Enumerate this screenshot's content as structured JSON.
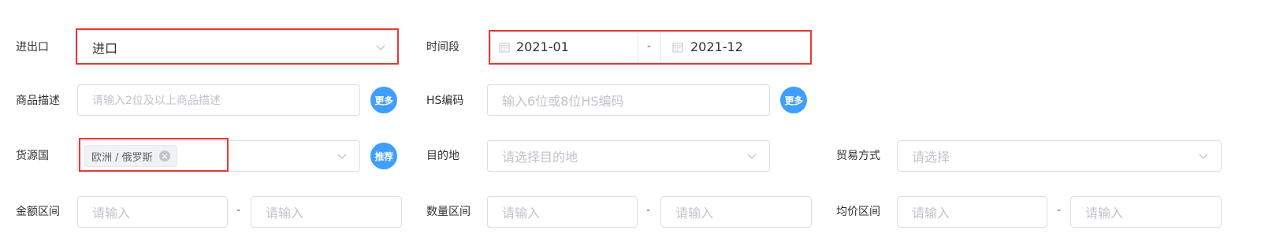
{
  "row1": {
    "import_export": {
      "label": "进出口",
      "value": "进口",
      "icon": "chevron-down-icon"
    },
    "period": {
      "label": "时间段",
      "start": "2021-01",
      "separator": "-",
      "end": "2021-12",
      "icon": "calendar-icon"
    }
  },
  "row2": {
    "product_desc": {
      "label": "商品描述",
      "placeholder": "请输入2位及以上商品描述",
      "more_label": "更多"
    },
    "hs_code": {
      "label": "HS编码",
      "placeholder": "输入6位或8位HS编码",
      "more_label": "更多"
    }
  },
  "row3": {
    "origin": {
      "label": "货源国",
      "tag": "欧洲 / 俄罗斯",
      "recommend_label": "推荐"
    },
    "destination": {
      "label": "目的地",
      "placeholder": "请选择目的地"
    },
    "trade_mode": {
      "label": "贸易方式",
      "placeholder": "请选择"
    }
  },
  "row4": {
    "amount_range": {
      "label": "金额区间",
      "min_placeholder": "请输入",
      "separator": "-",
      "max_placeholder": "请输入"
    },
    "quantity_range": {
      "label": "数量区间",
      "min_placeholder": "请输入",
      "separator": "-",
      "max_placeholder": "请输入"
    },
    "unit_price_range": {
      "label": "均价区间",
      "min_placeholder": "请输入",
      "separator": "-",
      "max_placeholder": "请输入"
    }
  },
  "colors": {
    "accent": "#409eff",
    "highlight": "#e53935",
    "border": "#dcdfe6",
    "placeholder": "#c0c4cc"
  }
}
